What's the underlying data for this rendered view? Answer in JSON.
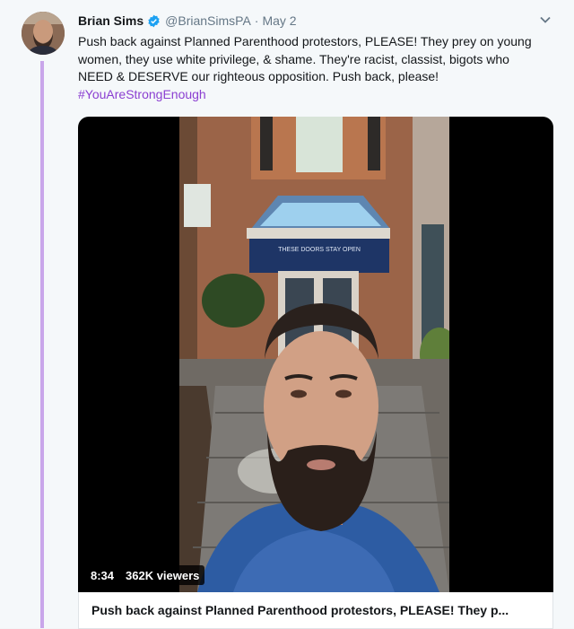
{
  "tweet": {
    "author_name": "Brian Sims",
    "handle": "@BrianSimsPA",
    "separator": "·",
    "date": "May 2",
    "text_lines": [
      "Push back against Planned Parenthood protestors, PLEASE! They prey on young",
      "women, they use white privilege, & shame. They're racist, classist, bigots who",
      "NEED & DESERVE our righteous opposition. Push back, please!"
    ],
    "hashtag": "#YouAreStrongEnough"
  },
  "video": {
    "duration": "8:34",
    "viewers": "362K viewers",
    "sign_text": "THESE DOORS STAY OPEN"
  },
  "card": {
    "title": "Push back against Planned Parenthood protestors, PLEASE! They p..."
  },
  "colors": {
    "thread_line": "#c9a6ea",
    "hashtag": "#8b3fd1",
    "verified": "#1da1f2"
  },
  "icons": {
    "verified": "verified-badge-icon",
    "menu": "chevron-down-icon"
  }
}
